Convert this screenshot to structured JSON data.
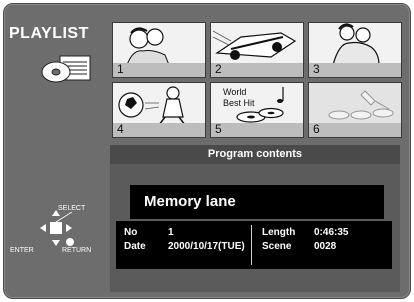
{
  "sidebar": {
    "title": "PLAYLIST",
    "select_label": "SELECT",
    "enter_label": "ENTER",
    "return_label": "RETURN"
  },
  "thumbnails": [
    {
      "number": "1",
      "caption": ""
    },
    {
      "number": "2",
      "caption": ""
    },
    {
      "number": "3",
      "caption": ""
    },
    {
      "number": "4",
      "caption": ""
    },
    {
      "number": "5",
      "caption_line1": "World",
      "caption_line2": "Best Hit"
    },
    {
      "number": "6",
      "caption": ""
    }
  ],
  "program": {
    "header": "Program contents",
    "title": "Memory lane",
    "no_label": "No",
    "no_value": "1",
    "date_label": "Date",
    "date_value": "2000/10/17(TUE)",
    "length_label": "Length",
    "length_value": "0:46:35",
    "scene_label": "Scene",
    "scene_value": "0028"
  },
  "colors": {
    "frame": "#6d6d6d",
    "panel": "#5b5b5b",
    "black_box": "#000000"
  }
}
